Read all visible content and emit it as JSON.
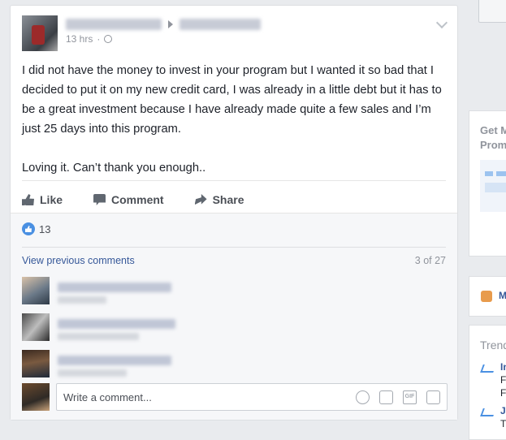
{
  "post": {
    "time": "13 hrs",
    "body": [
      "I did not have the money to invest in your program but I wanted it so bad that I decided to put it on my new credit card, I was already in a little debt but it has to be a great investment because I have already made quite a few sales and I’m just 25 days into this program.",
      "Loving it. Can’t thank you enough.."
    ],
    "actions": {
      "like": "Like",
      "comment": "Comment",
      "share": "Share"
    },
    "reactions_count": "13",
    "view_previous": "View previous comments",
    "comments_count": "3 of 27",
    "composer_placeholder": "Write a comment...",
    "composer_icons": [
      "emoji-icon",
      "camera-icon",
      "gif-icon",
      "sticker-icon"
    ],
    "gif_label": "GIF"
  },
  "sidebar": {
    "get_label": "Get M",
    "promo_label": "Prom",
    "m_link": "M",
    "trending_label": "Trend",
    "trend_items": [
      "In",
      "J"
    ],
    "trend_subs": [
      "F",
      "F",
      "T"
    ]
  },
  "colors": {
    "link": "#365899",
    "like_blue": "#4a90e2",
    "background": "#e9ebee"
  }
}
